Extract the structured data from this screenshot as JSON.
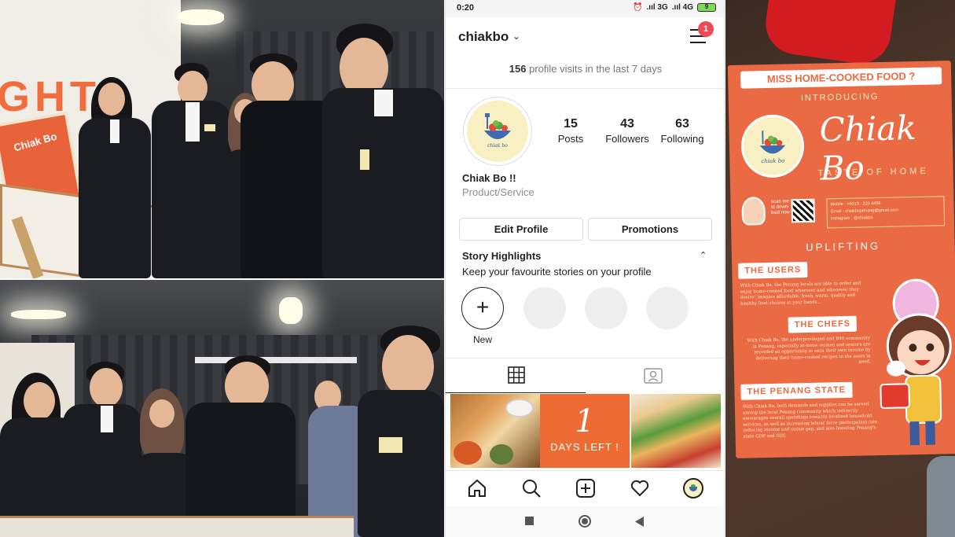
{
  "phone": {
    "status": {
      "time": "0:20",
      "network_1": ".ııl 3G",
      "network_2": ".ııl 4G",
      "battery": "9"
    },
    "header": {
      "username": "chiakbo",
      "menu_badge": "1"
    },
    "visits": {
      "count": "156",
      "text": "profile visits in the last 7 days"
    },
    "avatar": {
      "label": "chiak bo"
    },
    "stats": [
      {
        "value": "15",
        "label": "Posts"
      },
      {
        "value": "43",
        "label": "Followers"
      },
      {
        "value": "63",
        "label": "Following"
      }
    ],
    "profile": {
      "name": "Chiak Bo !!",
      "category": "Product/Service"
    },
    "buttons": {
      "edit": "Edit Profile",
      "promotions": "Promotions"
    },
    "highlights": {
      "title": "Story Highlights",
      "subtitle": "Keep your favourite stories on your profile",
      "new_label": "New"
    },
    "grid": {
      "days_number": "1",
      "days_text": "DAYS LEFT !"
    },
    "colors": {
      "notification": "#ed4956",
      "tile_orange": "#ee6b33"
    }
  },
  "collage": {
    "sign_text": "GHT",
    "poster_text": "Chiak Bo"
  },
  "flyer": {
    "banner": "MISS HOME-COOKED FOOD ?",
    "intro": "INTRODUCING",
    "brand": "Chiak Bo",
    "tagline": "TASTE OF HOME",
    "logo_label": "chiak bo",
    "scan_text": "scan me to down-load now",
    "contact": {
      "mobile": "Mobile      :  +6013 - 220 4456",
      "email": "Email        :  chiakbopenang@gmail.com",
      "instagram": "Instagram  :  @chiakbo"
    },
    "uplifting": "UPLIFTING",
    "sections": [
      {
        "title": "THE USERS",
        "text": "With Chiak Bo, the Penang locals are able to order and enjoy home-cooked food wherever and whenever they desire! Imagine affordable, fresh, warm, quality and healthy food choices at your hands..."
      },
      {
        "title": "THE CHEFS",
        "text": "With Chiak Bo, the underprivileged and B40 community in Penang, especially at-home women and seniors are provided an opportunity to earn their own income by delivering their home-cooked recipes to the users in need."
      },
      {
        "title": "THE PENANG STATE",
        "text": "With Chiak Bo, both demands and supplies can be served among the local Penang community which indirectly encourages overall spendings towards localized household services, as well as increasing labour force participation rate, reducing income and status gap, and also boosting Penang's state GDP and HDI."
      }
    ],
    "colors": {
      "flyer_orange": "#e96a43",
      "cloth_red": "#d31c1f"
    }
  }
}
